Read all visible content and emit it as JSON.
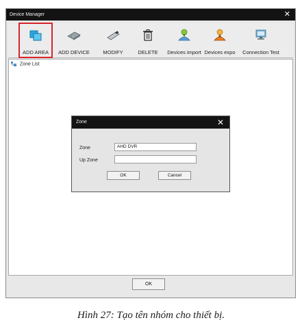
{
  "window": {
    "title": "Device Manager",
    "close_glyph": "✕"
  },
  "toolbar": {
    "items": [
      {
        "label": "ADD AREA",
        "icon": "add-area-icon",
        "selected": true
      },
      {
        "label": "ADD DEVICE",
        "icon": "add-device-icon"
      },
      {
        "label": "MODIFY",
        "icon": "modify-icon"
      },
      {
        "label": "DELETE",
        "icon": "trash-icon"
      },
      {
        "label": "Devices import",
        "icon": "import-icon"
      },
      {
        "label": "Devices expo",
        "icon": "export-icon"
      },
      {
        "label": "Connection Test",
        "icon": "connection-test-icon"
      }
    ],
    "selected_color": "#d8232a"
  },
  "zone_list": {
    "label": "Zone List"
  },
  "dialog": {
    "title": "Zone",
    "close_glyph": "✕",
    "zone_label": "Zone",
    "zone_value": "AHD DVR",
    "up_zone_label": "Up Zone",
    "up_zone_value": "",
    "ok_label": "OK",
    "cancel_label": "Cancel"
  },
  "footer": {
    "ok_label": "OK"
  },
  "caption": "Hình 27: Tạo tên nhóm cho thiết bị."
}
